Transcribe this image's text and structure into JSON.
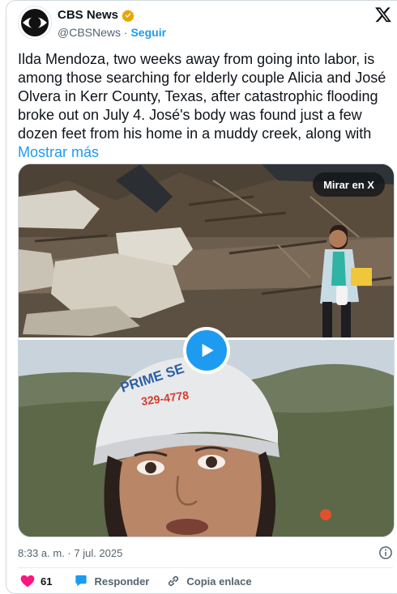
{
  "account": {
    "name": "CBS News",
    "handle": "@CBSNews",
    "separator": "·",
    "follow_label": "Seguir",
    "verified_color": "#e8a600",
    "logo": "cbs-eye-logo"
  },
  "tweet": {
    "text": "Ilda Mendoza, two weeks away from going into labor, is among those searching for elderly couple Alicia and José Olvera in Kerr County, Texas, after catastrophic flooding broke out on July 4. José's body was found just a few dozen feet from his home in a muddy creek, along with",
    "show_more_label": "Mostrar más",
    "timestamp": "8:33 a. m. · 7 jul. 2025"
  },
  "media": {
    "watch_on_x_label": "Mirar en X",
    "top_cap_text": "PRIME SE",
    "cap_phone": "329-4778",
    "play_icon": "play-icon"
  },
  "actions": {
    "likes_count": "61",
    "reply_label": "Responder",
    "copy_link_label": "Copia enlace",
    "like_color": "#f91880",
    "reply_color": "#1d9bf0"
  },
  "colors": {
    "accent": "#1d9bf0",
    "muted": "#536471"
  }
}
